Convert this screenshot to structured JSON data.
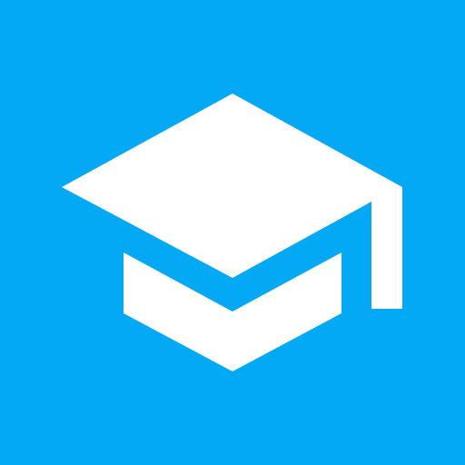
{
  "icon": {
    "name": "graduation-cap-icon",
    "background_color": "#03A9F4",
    "foreground_color": "#FFFFFF"
  }
}
